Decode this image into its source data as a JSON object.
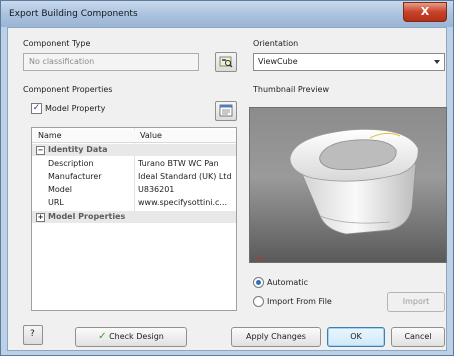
{
  "window": {
    "title": "Export Building Components",
    "close_label": "X"
  },
  "component_type": {
    "label": "Component Type",
    "value": "No classification"
  },
  "orientation": {
    "label": "Orientation",
    "selected": "ViewCube"
  },
  "component_properties": {
    "label": "Component Properties",
    "model_property_label": "Model Property",
    "model_property_checked": true
  },
  "grid": {
    "headers": {
      "name": "Name",
      "value": "Value"
    },
    "identity_category": "Identity Data",
    "rows": [
      {
        "name": "Description",
        "value": "Turano BTW WC Pan"
      },
      {
        "name": "Manufacturer",
        "value": "Ideal Standard (UK) Ltd"
      },
      {
        "name": "Model",
        "value": "U836201"
      },
      {
        "name": "URL",
        "value": "www.specifysottini.c..."
      }
    ],
    "model_category": "Model Properties"
  },
  "thumbnail": {
    "label": "Thumbnail Preview",
    "automatic_label": "Automatic",
    "import_from_file_label": "Import From File",
    "selected": "Automatic",
    "import_button": "Import"
  },
  "footer": {
    "help_label": "?",
    "check_design": "Check Design",
    "apply_changes": "Apply Changes",
    "ok": "OK",
    "cancel": "Cancel"
  }
}
